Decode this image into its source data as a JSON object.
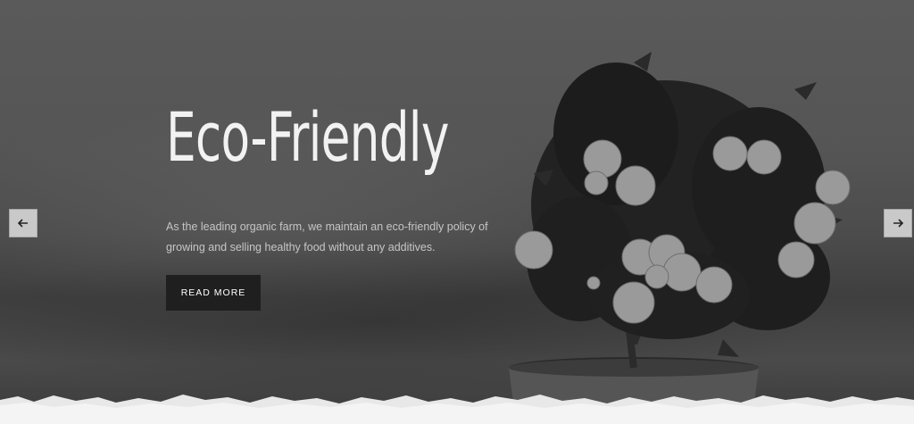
{
  "hero": {
    "title": "Eco-Friendly",
    "description": "As the leading organic farm, we maintain an eco-friendly policy of growing and selling healthy food without any additives.",
    "button_label": "READ MORE"
  },
  "slider": {
    "prev_icon": "arrow-left-icon",
    "next_icon": "arrow-right-icon"
  },
  "colors": {
    "button_bg": "#1f1f1f",
    "title": "#f2f2f2",
    "text": "#c6c6c6",
    "arrow_bg": "#c9c9c9"
  }
}
